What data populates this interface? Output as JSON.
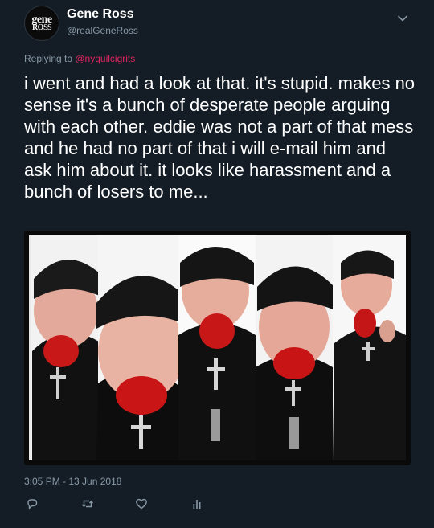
{
  "author": {
    "display_name": "Gene Ross",
    "handle": "@realGeneRoss",
    "avatar_logo": {
      "line1": "gene",
      "line2": "ROSS"
    }
  },
  "reply": {
    "prefix": "Replying to ",
    "mention": "@nyquilcigrits"
  },
  "tweet": {
    "text": "i went and had a look at that. it's stupid. makes no sense it's a bunch of desperate people arguing with each other. eddie was not a part of that mess and he had no part of that i will e-mail him and ask him about it. it looks like harassment and a bunch of losers to me...",
    "timestamp": "3:05 PM - 13 Jun 2018"
  },
  "media": {
    "type": "photo-collage",
    "panel_count": 5
  },
  "actions": [
    {
      "name": "reply-icon"
    },
    {
      "name": "retweet-icon"
    },
    {
      "name": "like-icon"
    },
    {
      "name": "analytics-icon"
    }
  ],
  "colors": {
    "background": "#141d26",
    "text": "#ffffff",
    "secondary": "#8899a6",
    "mention": "#e0245e"
  }
}
